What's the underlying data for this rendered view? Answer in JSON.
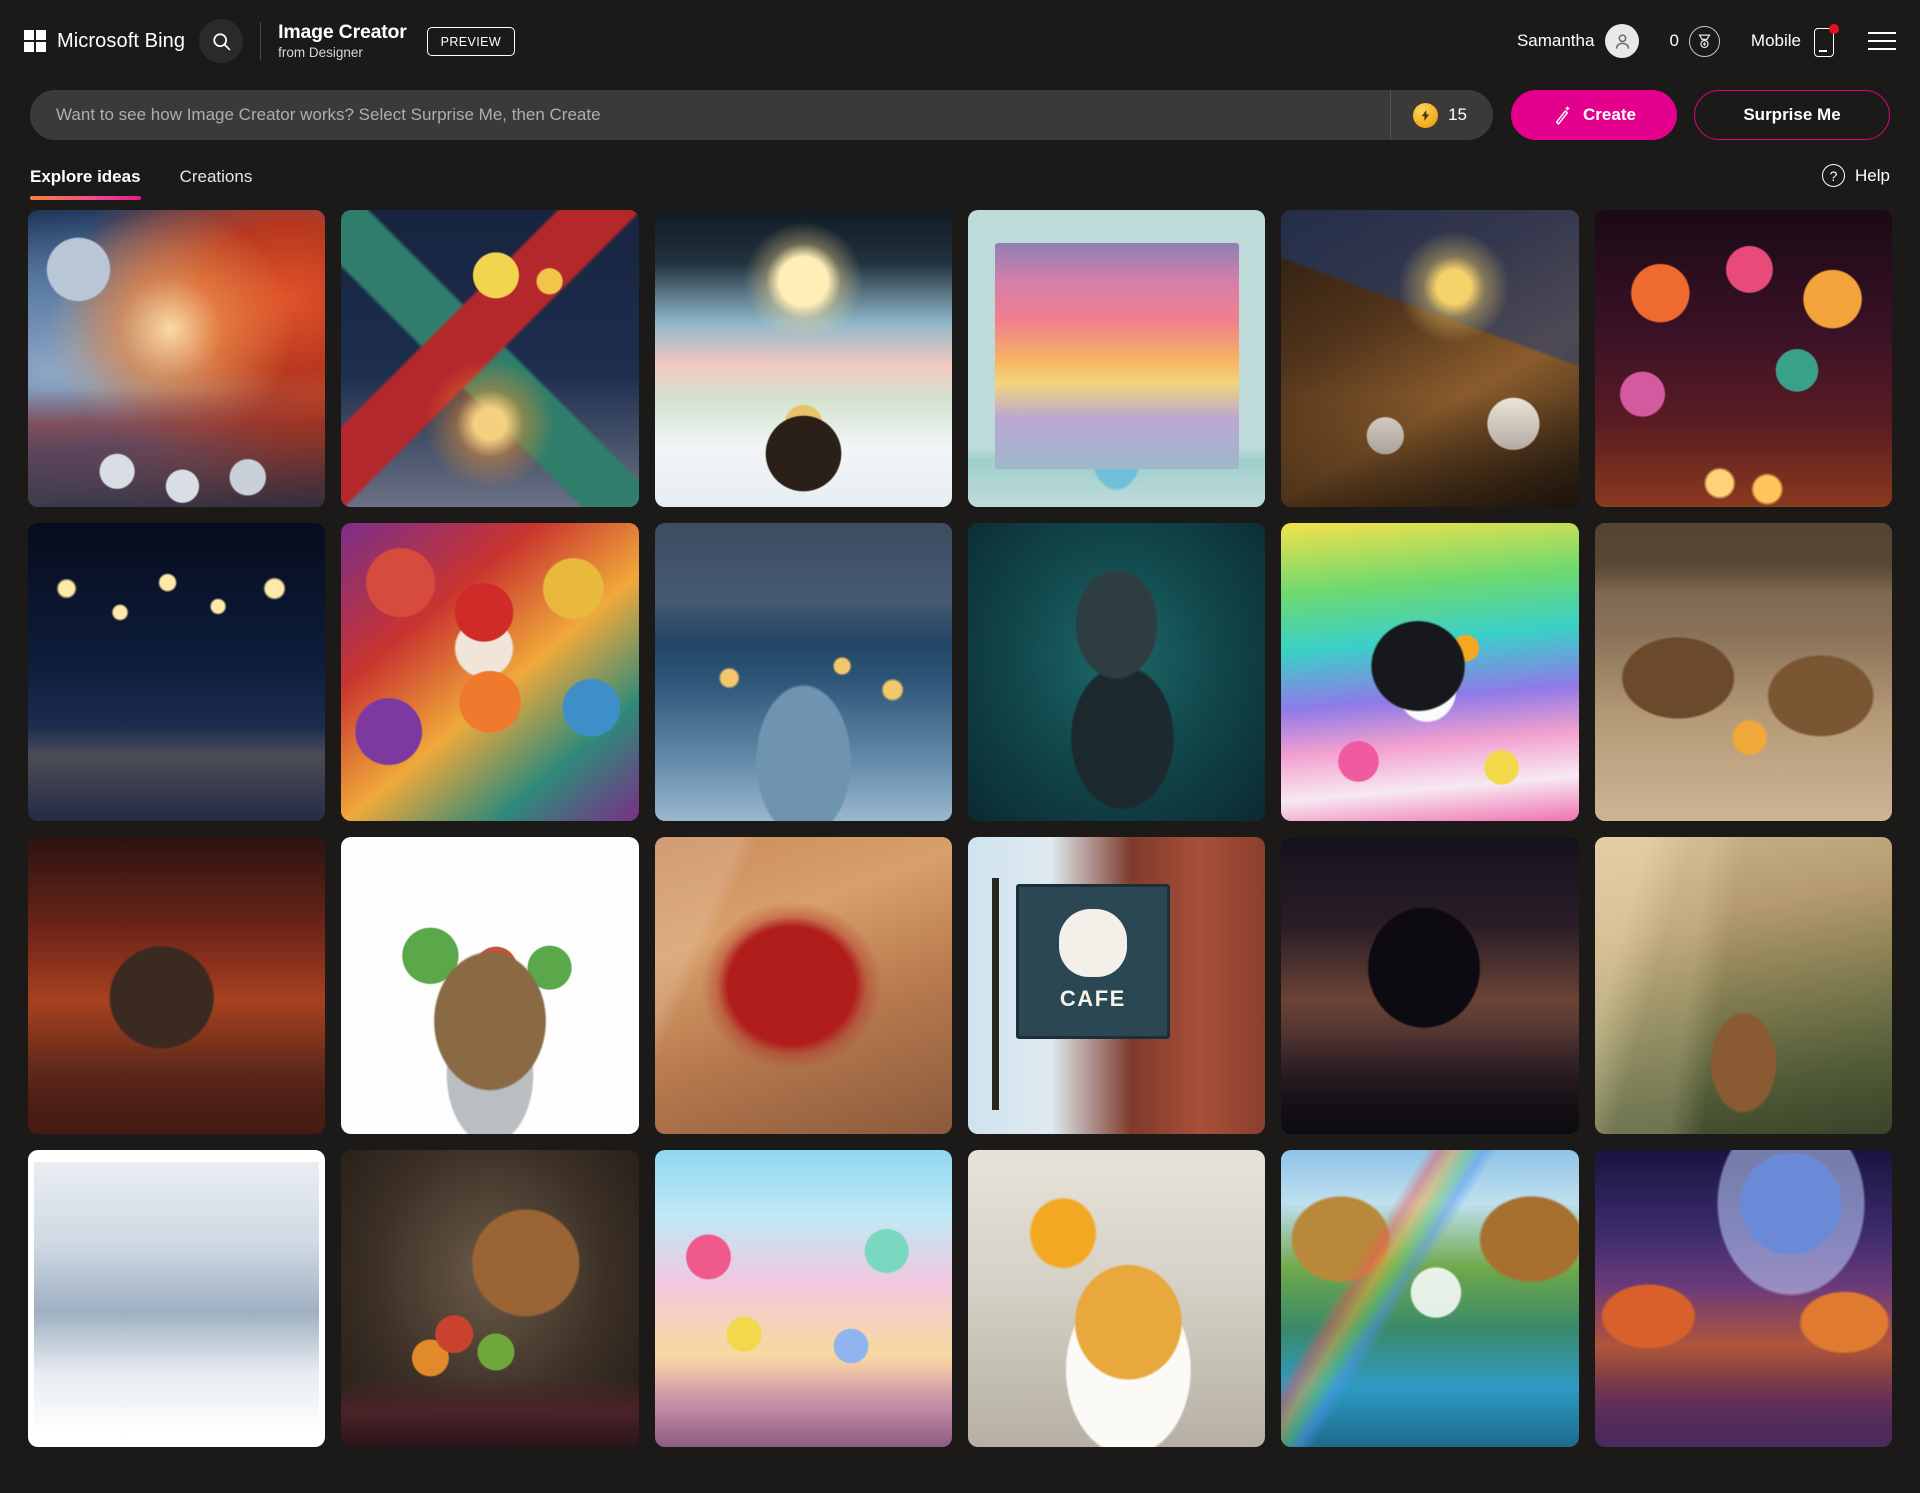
{
  "header": {
    "logo_icon": "microsoft-grid-icon",
    "brand": "Microsoft Bing",
    "search_icon": "search-icon",
    "app_title": "Image Creator",
    "app_subtitle": "from Designer",
    "preview_badge": "PREVIEW",
    "account_name": "Samantha",
    "account_icon": "person-avatar-icon",
    "rewards_count": "0",
    "rewards_icon": "rewards-medal-icon",
    "mobile_label": "Mobile",
    "mobile_icon": "phone-icon",
    "menu_icon": "hamburger-menu-icon"
  },
  "prompt": {
    "placeholder": "Want to see how Image Creator works? Select Surprise Me, then Create",
    "value": "",
    "boost_icon": "boost-coin-icon",
    "boost_count": "15",
    "create_icon": "magic-wand-icon",
    "create_label": "Create",
    "surprise_label": "Surprise Me"
  },
  "tabs": {
    "items": [
      {
        "label": "Explore ideas",
        "active": true
      },
      {
        "label": "Creations",
        "active": false
      }
    ],
    "help_icon": "question-circle-icon",
    "help_label": "Help"
  },
  "colors": {
    "page_bg": "#1b1a19",
    "accent_pink": "#e3008c",
    "input_bg": "#3b3a39",
    "tab_underline_from": "#f4823b",
    "tab_underline_to": "#e6198f",
    "notification_dot": "#e81123"
  },
  "gallery": {
    "tiles": [
      {
        "alt": "Choir in red robes singing under a moon with floating music notes",
        "art": "a-choir"
      },
      {
        "alt": "Felt craft village scene with children around a campfire at night",
        "art": "a-felt"
      },
      {
        "alt": "Wool needle-felted winter landscape with a figure facing a glowing sky",
        "art": "a-wool"
      },
      {
        "alt": "Paper craft diorama of a pagoda theme park with ferris wheels",
        "art": "a-paper"
      },
      {
        "alt": "Stained glass style family singing at a piano with menorah and cats",
        "art": "a-piano"
      },
      {
        "alt": "Colorful festival lanterns and candles with silhouetted figures",
        "art": "a-diwali"
      },
      {
        "alt": "Night town with hanging stars and moons over lit houses",
        "art": "a-starcity"
      },
      {
        "alt": "Santa figure surrounded by ornate ornaments and a colorful fish",
        "art": "a-santa"
      },
      {
        "alt": "Snowy village with ice skaters on a frozen pond at dusk",
        "art": "a-village"
      },
      {
        "alt": "Teal metallic robot head portrait on dark background",
        "art": "a-robot"
      },
      {
        "alt": "Cute penguin dancing on a pink platform with rainbow and balls",
        "art": "a-penguin"
      },
      {
        "alt": "Two bears in a cozy cave den by a campfire",
        "art": "a-bears"
      },
      {
        "alt": "Wooden cabin in a red autumn forest with lit windows",
        "art": "a-cabin"
      },
      {
        "alt": "Isometric miniature pagoda village diorama on white",
        "art": "a-iso"
      },
      {
        "alt": "Close-up red maple leaf with blurred autumn background",
        "art": "a-leaf"
      },
      {
        "alt": "CAFE hanging sign with polar bear holding coffee on brick wall",
        "art": "a-cafe",
        "sign_text": "CAFE"
      },
      {
        "alt": "Dark gothic castle with a cloaked figure in misty ruins",
        "art": "a-castle"
      },
      {
        "alt": "Fox walking through a sunlit misty forest",
        "art": "a-fox"
      },
      {
        "alt": "Vintage postage stamp engraving of snowy mountains and pines",
        "art": "a-stamp"
      },
      {
        "alt": "Cornucopia overflowing with fruits and vegetables on a table",
        "art": "a-corn"
      },
      {
        "alt": "Candy land city street with lollipops and cake skyscrapers",
        "art": "a-candy"
      },
      {
        "alt": "Stack of pancakes with butter and syrup beside orange juice",
        "art": "a-pancake"
      },
      {
        "alt": "Unicorn by a waterfall with rainbow in an autumn canyon",
        "art": "a-unicorn"
      },
      {
        "alt": "Fantasy alien planet rising over a purple and orange forest",
        "art": "a-planet"
      }
    ]
  }
}
